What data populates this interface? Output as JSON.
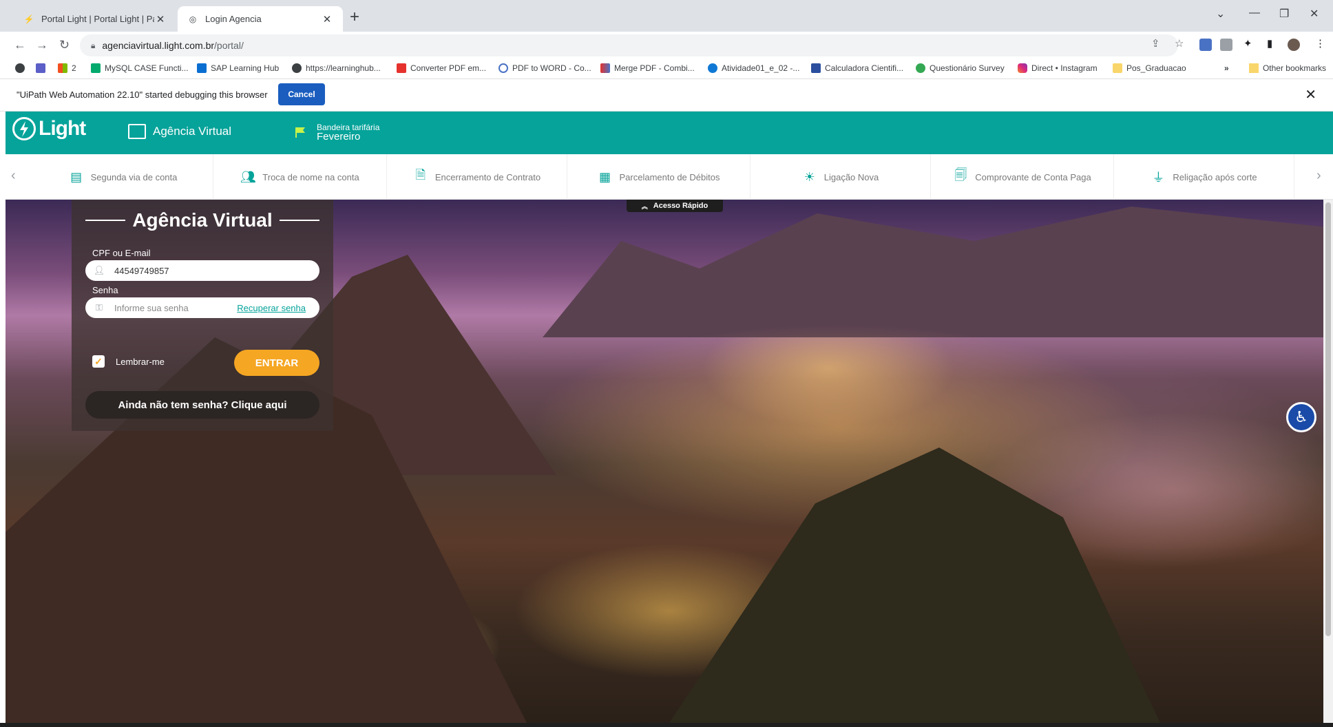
{
  "browser": {
    "tabs": [
      {
        "title": "Portal Light | Portal Light | Para E",
        "active": false
      },
      {
        "title": "Login Agencia",
        "active": true
      }
    ],
    "url_domain": "agenciavirtual.light.com.br",
    "url_path": "/portal/",
    "bookmarks": [
      {
        "label": "",
        "icon": "globe-icon"
      },
      {
        "label": "",
        "icon": "teams-icon"
      },
      {
        "label": "2",
        "icon": "windows-icon"
      },
      {
        "label": "MySQL CASE Functi...",
        "icon": "w3schools-icon"
      },
      {
        "label": "SAP Learning Hub",
        "icon": "sap-icon"
      },
      {
        "label": "https://learninghub...",
        "icon": "globe-icon"
      },
      {
        "label": "Converter PDF em...",
        "icon": "pdf-icon"
      },
      {
        "label": "PDF to WORD - Co...",
        "icon": "convert-icon"
      },
      {
        "label": "Merge PDF - Combi...",
        "icon": "pdf-icon"
      },
      {
        "label": "Atividade01_e_02 -...",
        "icon": "onedrive-icon"
      },
      {
        "label": "Calculadora Cientifi...",
        "icon": "calculator-icon"
      },
      {
        "label": "Questionário Survey",
        "icon": "survey-icon"
      },
      {
        "label": "Direct • Instagram",
        "icon": "instagram-icon"
      },
      {
        "label": "Pos_Graduacao",
        "icon": "folder-icon"
      }
    ],
    "bookmarks_more": "»",
    "other_bookmarks": "Other bookmarks",
    "infobar": {
      "message": "\"UiPath Web Automation 22.10\" started debugging this browser",
      "cancel_label": "Cancel"
    }
  },
  "site": {
    "logo_text": "Light",
    "agencia_label": "Agência Virtual",
    "bandeira_label": "Bandeira tarifária",
    "bandeira_value": "Fevereiro",
    "quicknav": [
      {
        "label": "Segunda via de conta",
        "icon": "bill-icon"
      },
      {
        "label": "Troca de nome na conta",
        "icon": "users-icon"
      },
      {
        "label": "Encerramento de Contrato",
        "icon": "document-close-icon"
      },
      {
        "label": "Parcelamento de Débitos",
        "icon": "calculator-icon"
      },
      {
        "label": "Ligação Nova",
        "icon": "light-bulb-icon"
      },
      {
        "label": "Comprovante de Conta Paga",
        "icon": "receipt-icon"
      },
      {
        "label": "Religação após corte",
        "icon": "plug-icon"
      }
    ],
    "acesso_rapido": "Acesso Rápido",
    "login": {
      "title": "Agência Virtual",
      "cpf_label": "CPF ou E-mail",
      "cpf_value": "44549749857",
      "senha_label": "Senha",
      "senha_placeholder": "Informe sua senha",
      "recover_label": "Recuperar senha",
      "remember_label": "Lembrar-me",
      "remember_checked": true,
      "submit_label": "ENTRAR",
      "signup_label": "Ainda não tem senha? Clique aqui"
    }
  },
  "colors": {
    "brand_teal": "#06a39a",
    "cta_orange": "#f5a623",
    "infobar_button": "#1a5dbf"
  }
}
